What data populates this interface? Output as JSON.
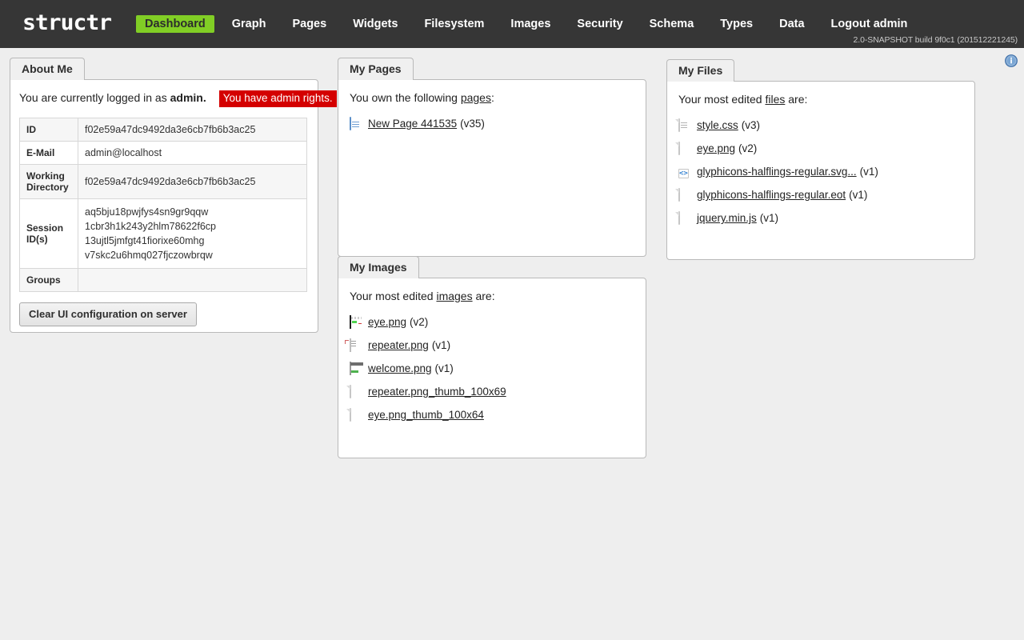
{
  "header": {
    "logo": "structr",
    "version": "2.0-SNAPSHOT build 9f0c1 (201512221245)",
    "nav": [
      {
        "label": "Dashboard",
        "active": true
      },
      {
        "label": "Graph",
        "active": false
      },
      {
        "label": "Pages",
        "active": false
      },
      {
        "label": "Widgets",
        "active": false
      },
      {
        "label": "Filesystem",
        "active": false
      },
      {
        "label": "Images",
        "active": false
      },
      {
        "label": "Security",
        "active": false
      },
      {
        "label": "Schema",
        "active": false
      },
      {
        "label": "Types",
        "active": false
      },
      {
        "label": "Data",
        "active": false
      },
      {
        "label": "Logout admin",
        "active": false
      }
    ]
  },
  "colors": {
    "header_bg": "#363636",
    "accent_green": "#81ce25",
    "badge_red": "#d40000",
    "page_bg": "#eeeeee",
    "panel_border": "#b9b9b9"
  },
  "info_icon": "info-circle-icon",
  "about": {
    "tab": "About Me",
    "logged_in_prefix": "You are currently logged in as ",
    "logged_in_user": "admin.",
    "admin_badge": "You have admin rights.",
    "rows": [
      {
        "key": "ID",
        "value": "f02e59a47dc9492da3e6cb7fb6b3ac25"
      },
      {
        "key": "E-Mail",
        "value": "admin@localhost"
      },
      {
        "key": "Working Directory",
        "value": "f02e59a47dc9492da3e6cb7fb6b3ac25"
      },
      {
        "key": "Session ID(s)",
        "value": ""
      },
      {
        "key": "Groups",
        "value": ""
      }
    ],
    "session_ids": [
      "aq5bju18pwjfys4sn9gr9qqw",
      "1cbr3h1k243y2hlm78622f6cp",
      "13ujtl5jmfgt41fiorixe60mhg",
      "v7skc2u6hmq027fjczowbrqw"
    ],
    "clear_button": "Clear UI configuration on server"
  },
  "pages": {
    "tab": "My Pages",
    "intro_before": "You own the following ",
    "intro_link": "pages",
    "intro_after": ":",
    "items": [
      {
        "icon": "page-icon",
        "name": "New Page 441535",
        "version": "(v35)"
      }
    ]
  },
  "images": {
    "tab": "My Images",
    "intro_before": "Your most edited ",
    "intro_link": "images",
    "intro_after": " are:",
    "items": [
      {
        "icon": "image-thumbnail-eye",
        "name": "eye.png",
        "version": "(v2)"
      },
      {
        "icon": "image-thumbnail-repeater",
        "name": "repeater.png",
        "version": "(v1)"
      },
      {
        "icon": "image-thumbnail-welcome",
        "name": "welcome.png",
        "version": "(v1)"
      },
      {
        "icon": "file-sheet-icon",
        "name": "repeater.png_thumb_100x69",
        "version": ""
      },
      {
        "icon": "file-sheet-icon",
        "name": "eye.png_thumb_100x64",
        "version": ""
      }
    ]
  },
  "files": {
    "tab": "My Files",
    "intro_before": "Your most edited ",
    "intro_link": "files",
    "intro_after": " are:",
    "items": [
      {
        "icon": "css-sheet-icon",
        "name": "style.css",
        "version": "(v3)"
      },
      {
        "icon": "file-sheet-icon",
        "name": "eye.png",
        "version": "(v2)"
      },
      {
        "icon": "code-sheet-icon",
        "name": "glyphicons-halflings-regular.svg...",
        "version": "(v1)"
      },
      {
        "icon": "file-sheet-icon",
        "name": "glyphicons-halflings-regular.eot",
        "version": "(v1)"
      },
      {
        "icon": "file-sheet-icon",
        "name": "jquery.min.js",
        "version": "(v1)"
      }
    ]
  }
}
